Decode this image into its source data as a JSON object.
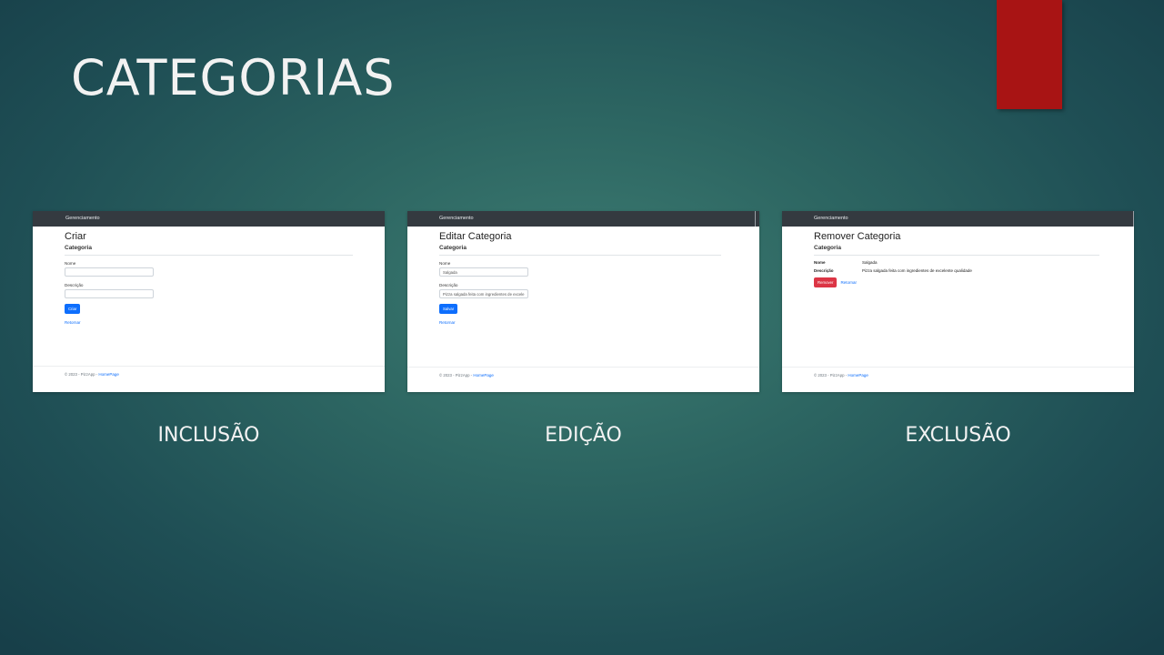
{
  "slide": {
    "title": "CATEGORIAS",
    "accent_color": "#a81414"
  },
  "screens": [
    {
      "navbar": "Gerenciamento",
      "heading": "Criar",
      "subheading": "Categoria",
      "fields": [
        {
          "label": "Nome",
          "value": ""
        },
        {
          "label": "Descrição",
          "value": ""
        }
      ],
      "button": "Criar",
      "back_link": "Retornar",
      "footer_text": "© 2023 - PizzApp - ",
      "footer_link": "HomePage",
      "caption": "INCLUSÃO"
    },
    {
      "navbar": "Gerenciamento",
      "heading": "Editar Categoria",
      "subheading": "Categoria",
      "fields": [
        {
          "label": "Nome",
          "value": "Salgada"
        },
        {
          "label": "Descrição",
          "value": "Pizza salgada feita com ingredientes de excele"
        }
      ],
      "button": "Salvar",
      "back_link": "Retornar",
      "footer_text": "© 2023 - PizzApp - ",
      "footer_link": "HomePage",
      "caption": "EDIÇÃO"
    },
    {
      "navbar": "Gerenciamento",
      "heading": "Remover Categoria",
      "subheading": "Categoria",
      "details": [
        {
          "term": "Nome",
          "value": "Salgada"
        },
        {
          "term": "Descrição",
          "value": "Pizza salgada feita com ingredientes de excelente qualidade"
        }
      ],
      "button": "Remover",
      "back_link": "Retornar",
      "footer_text": "© 2023 - PizzApp - ",
      "footer_link": "HomePage",
      "caption": "EXCLUSÃO"
    }
  ],
  "colors": {
    "primary_button": "#0d6efd",
    "danger_button": "#dc3545",
    "navbar": "#343a40"
  }
}
